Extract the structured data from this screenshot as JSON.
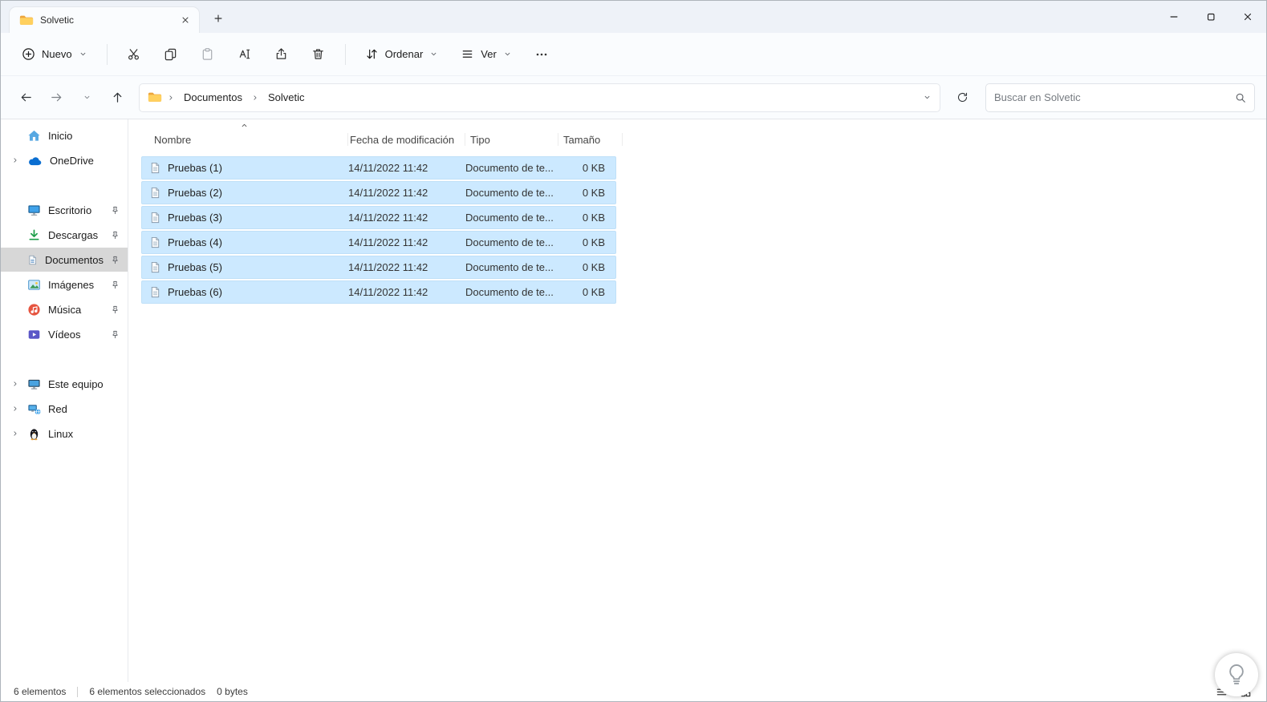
{
  "window": {
    "tab_title": "Solvetic"
  },
  "toolbar": {
    "new_label": "Nuevo",
    "sort_label": "Ordenar",
    "view_label": "Ver"
  },
  "navbar": {
    "breadcrumb": [
      {
        "label": "Documentos"
      },
      {
        "label": "Solvetic"
      }
    ],
    "search_placeholder": "Buscar en Solvetic"
  },
  "sidebar": {
    "items": [
      {
        "label": "Inicio"
      },
      {
        "label": "OneDrive"
      },
      {
        "label": "Escritorio"
      },
      {
        "label": "Descargas"
      },
      {
        "label": "Documentos"
      },
      {
        "label": "Imágenes"
      },
      {
        "label": "Música"
      },
      {
        "label": "Vídeos"
      },
      {
        "label": "Este equipo"
      },
      {
        "label": "Red"
      },
      {
        "label": "Linux"
      }
    ]
  },
  "filelist": {
    "columns": {
      "name": "Nombre",
      "date": "Fecha de modificación",
      "type": "Tipo",
      "size": "Tamaño"
    },
    "rows": [
      {
        "name": "Pruebas (1)",
        "date": "14/11/2022 11:42",
        "type": "Documento de te...",
        "size": "0 KB"
      },
      {
        "name": "Pruebas (2)",
        "date": "14/11/2022 11:42",
        "type": "Documento de te...",
        "size": "0 KB"
      },
      {
        "name": "Pruebas (3)",
        "date": "14/11/2022 11:42",
        "type": "Documento de te...",
        "size": "0 KB"
      },
      {
        "name": "Pruebas (4)",
        "date": "14/11/2022 11:42",
        "type": "Documento de te...",
        "size": "0 KB"
      },
      {
        "name": "Pruebas (5)",
        "date": "14/11/2022 11:42",
        "type": "Documento de te...",
        "size": "0 KB"
      },
      {
        "name": "Pruebas (6)",
        "date": "14/11/2022 11:42",
        "type": "Documento de te...",
        "size": "0 KB"
      }
    ]
  },
  "statusbar": {
    "item_count": "6 elementos",
    "selected_count": "6 elementos seleccionados",
    "selected_size": "0 bytes"
  },
  "colors": {
    "selection": "#cce9ff",
    "accent": "#0067c0",
    "folder_yellow": "#ffd05e"
  }
}
